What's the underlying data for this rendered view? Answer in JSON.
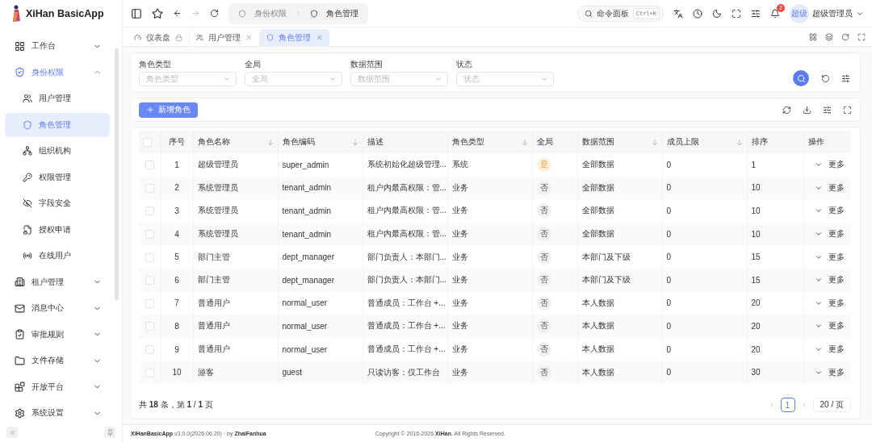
{
  "app": {
    "name": "XiHan BasicApp"
  },
  "sidebar": {
    "items": [
      {
        "label": "工作台",
        "expanded": false,
        "selected": false
      },
      {
        "label": "身份权限",
        "expanded": true,
        "selected": false,
        "active": true,
        "children": [
          {
            "label": "用户管理",
            "selected": false
          },
          {
            "label": "角色管理",
            "selected": true
          },
          {
            "label": "组织机构",
            "selected": false
          },
          {
            "label": "权限管理",
            "selected": false
          },
          {
            "label": "字段安全",
            "selected": false
          },
          {
            "label": "授权申请",
            "selected": false
          },
          {
            "label": "在线用户",
            "selected": false
          }
        ]
      },
      {
        "label": "租户管理",
        "expanded": false,
        "selected": false
      },
      {
        "label": "消息中心",
        "expanded": false,
        "selected": false
      },
      {
        "label": "审批规则",
        "expanded": false,
        "selected": false
      },
      {
        "label": "文件存储",
        "expanded": false,
        "selected": false
      },
      {
        "label": "开放平台",
        "expanded": false,
        "selected": false
      },
      {
        "label": "系统设置",
        "expanded": false,
        "selected": false
      }
    ]
  },
  "header": {
    "breadcrumb": [
      "身份权限",
      "角色管理"
    ],
    "command": {
      "label": "命令面板",
      "shortcut": "Ctrl+K"
    },
    "notifications": "2",
    "user": {
      "avatar": "超级",
      "name": "超级管理员"
    }
  },
  "tabs": [
    {
      "label": "仪表盘",
      "selected": false,
      "locked": true
    },
    {
      "label": "用户管理",
      "selected": false,
      "locked": false
    },
    {
      "label": "角色管理",
      "selected": true,
      "locked": false
    }
  ],
  "filters": [
    {
      "label": "角色类型",
      "placeholder": "角色类型"
    },
    {
      "label": "全局",
      "placeholder": "全局"
    },
    {
      "label": "数据范围",
      "placeholder": "数据范围"
    },
    {
      "label": "状态",
      "placeholder": "状态"
    }
  ],
  "toolbar": {
    "add_button": "新增角色"
  },
  "table": {
    "all_checked": false,
    "columns": [
      {
        "label": "序号",
        "sortable": false
      },
      {
        "label": "角色名称",
        "sortable": true
      },
      {
        "label": "角色编码",
        "sortable": true
      },
      {
        "label": "描述",
        "sortable": false
      },
      {
        "label": "角色类型",
        "sortable": true
      },
      {
        "label": "全局",
        "sortable": false
      },
      {
        "label": "数据范围",
        "sortable": true
      },
      {
        "label": "成员上限",
        "sortable": true
      },
      {
        "label": "排序",
        "sortable": false
      },
      {
        "label": "操作",
        "sortable": false
      }
    ],
    "rows": [
      {
        "checked": false,
        "no": "1",
        "name": "超级管理员",
        "code": "super_admin",
        "desc": "系统初始化超级管理...",
        "type": "系统",
        "global": {
          "text": "是",
          "on": true
        },
        "scope": "全部数据",
        "limit": "0",
        "sort": "1",
        "action": "更多"
      },
      {
        "checked": false,
        "no": "2",
        "name": "系统管理员",
        "code": "tenant_admin",
        "desc": "租户内最高权限：管...",
        "type": "业务",
        "global": {
          "text": "否",
          "on": false
        },
        "scope": "全部数据",
        "limit": "0",
        "sort": "10",
        "action": "更多"
      },
      {
        "checked": false,
        "no": "3",
        "name": "系统管理员",
        "code": "tenant_admin",
        "desc": "租户内最高权限：管...",
        "type": "业务",
        "global": {
          "text": "否",
          "on": false
        },
        "scope": "全部数据",
        "limit": "0",
        "sort": "10",
        "action": "更多"
      },
      {
        "checked": false,
        "no": "4",
        "name": "系统管理员",
        "code": "tenant_admin",
        "desc": "租户内最高权限：管...",
        "type": "业务",
        "global": {
          "text": "否",
          "on": false
        },
        "scope": "全部数据",
        "limit": "0",
        "sort": "10",
        "action": "更多"
      },
      {
        "checked": false,
        "no": "5",
        "name": "部门主管",
        "code": "dept_manager",
        "desc": "部门负责人：本部门...",
        "type": "业务",
        "global": {
          "text": "否",
          "on": false
        },
        "scope": "本部门及下级",
        "limit": "0",
        "sort": "15",
        "action": "更多"
      },
      {
        "checked": false,
        "no": "6",
        "name": "部门主管",
        "code": "dept_manager",
        "desc": "部门负责人：本部门...",
        "type": "业务",
        "global": {
          "text": "否",
          "on": false
        },
        "scope": "本部门及下级",
        "limit": "0",
        "sort": "15",
        "action": "更多"
      },
      {
        "checked": false,
        "no": "7",
        "name": "普通用户",
        "code": "normal_user",
        "desc": "普通成员：工作台 +...",
        "type": "业务",
        "global": {
          "text": "否",
          "on": false
        },
        "scope": "本人数据",
        "limit": "0",
        "sort": "20",
        "action": "更多"
      },
      {
        "checked": false,
        "no": "8",
        "name": "普通用户",
        "code": "normal_user",
        "desc": "普通成员：工作台 +...",
        "type": "业务",
        "global": {
          "text": "否",
          "on": false
        },
        "scope": "本人数据",
        "limit": "0",
        "sort": "20",
        "action": "更多"
      },
      {
        "checked": false,
        "no": "9",
        "name": "普通用户",
        "code": "normal_user",
        "desc": "普通成员：工作台 +...",
        "type": "业务",
        "global": {
          "text": "否",
          "on": false
        },
        "scope": "本人数据",
        "limit": "0",
        "sort": "20",
        "action": "更多"
      },
      {
        "checked": false,
        "no": "10",
        "name": "游客",
        "code": "guest",
        "desc": "只读访客：仅工作台",
        "type": "业务",
        "global": {
          "text": "否",
          "on": false
        },
        "scope": "本人数据",
        "limit": "0",
        "sort": "30",
        "action": "更多"
      }
    ]
  },
  "pagination": {
    "summary": "共 **18** 条，第 **1** / **1** 页",
    "pages": [
      {
        "label": "1",
        "selected": true
      }
    ],
    "page_size": "20 / 页"
  },
  "footer": {
    "version": "**XiHanBasicApp** v3.0.0(2026.06.20) · by **ZhaiFanhua**",
    "copyright": "Copyright © 2016-2026 **XiHan**. All Rights Reserved."
  }
}
